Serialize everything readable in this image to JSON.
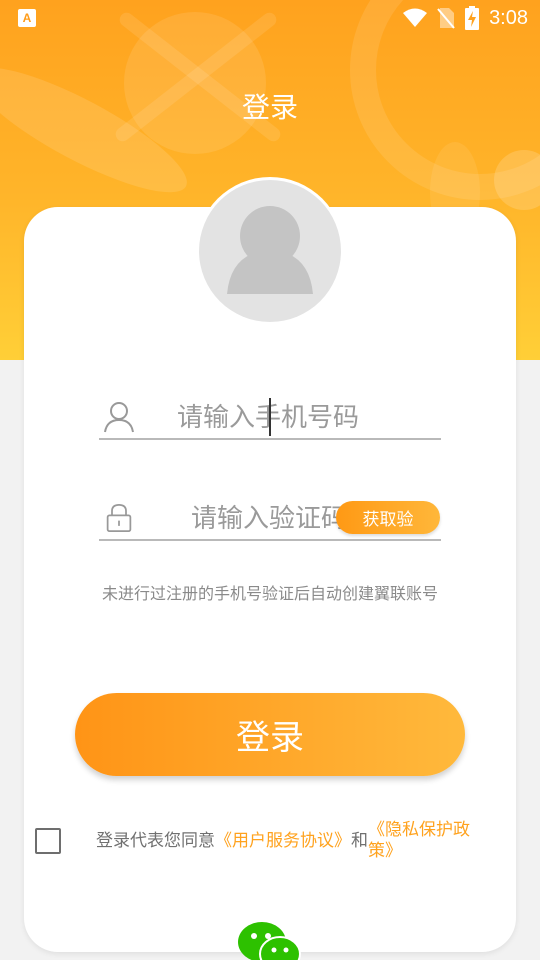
{
  "status_bar": {
    "app_icon_label": "A",
    "time": "3:08",
    "icons": [
      "wifi-icon",
      "no-sim-icon",
      "battery-charging-icon"
    ]
  },
  "header": {
    "title": "登录"
  },
  "form": {
    "phone_placeholder": "请输入手机号码",
    "code_placeholder": "请输入验证码",
    "get_code_label": "获取验",
    "hint": "未进行过注册的手机号验证后自动创建翼联账号",
    "login_label": "登录"
  },
  "agreement": {
    "prefix": "登录代表您同意",
    "user_agreement": "《用户服务协议》",
    "conjunction": "和",
    "privacy_policy": "《隐私保护政策》",
    "checked": false
  },
  "social": {
    "wechat_icon": "wechat-icon"
  },
  "colors": {
    "accent": "#ffa21e",
    "accent_light": "#ffb93c"
  }
}
